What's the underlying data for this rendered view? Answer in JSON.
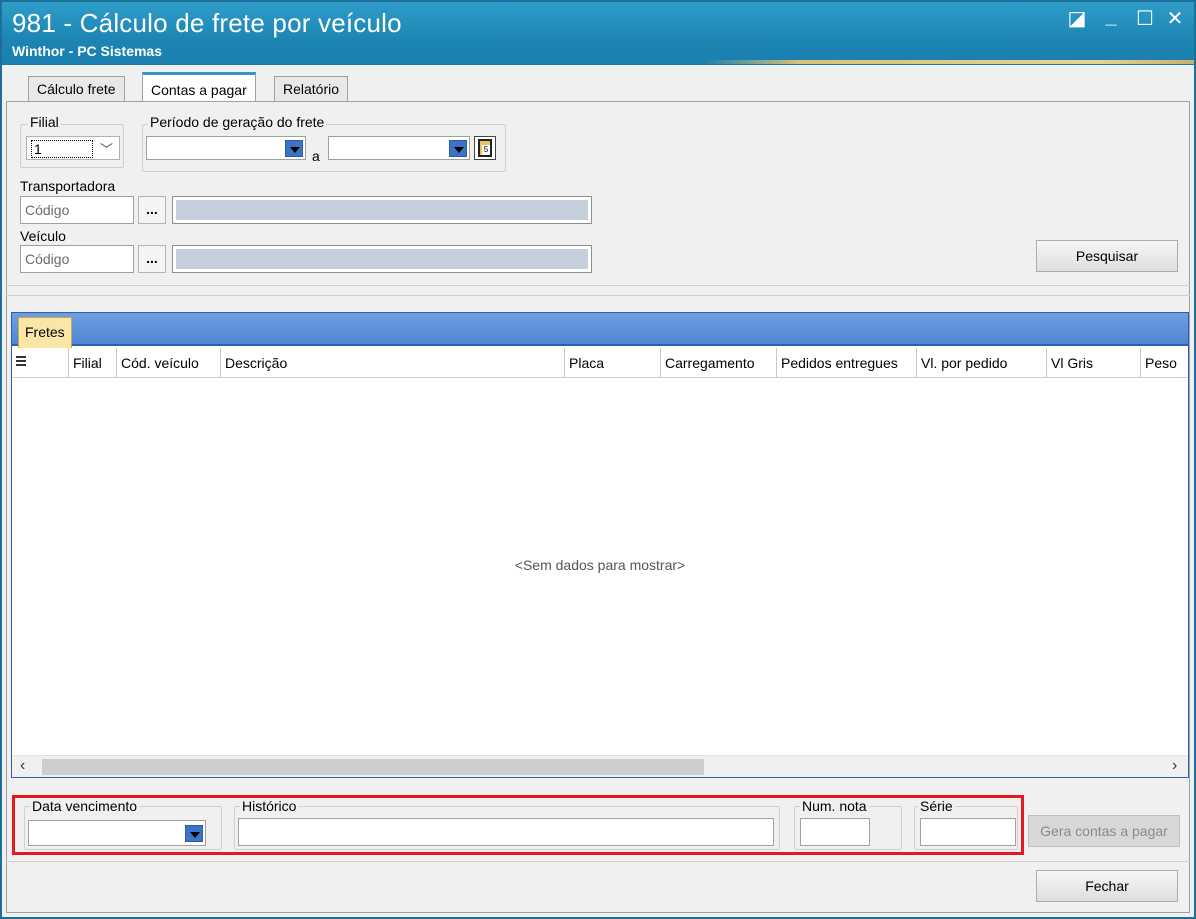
{
  "window": {
    "title": "981 - Cálculo de frete por veículo",
    "subtitle": "Winthor - PC Sistemas",
    "controls": [
      "◪",
      "_",
      "☐",
      "✕"
    ]
  },
  "tabs": [
    {
      "label": "Cálculo frete",
      "active": false
    },
    {
      "label": "Contas a pagar",
      "active": true
    },
    {
      "label": "Relatório",
      "active": false
    }
  ],
  "filters": {
    "filial_label": "Filial",
    "filial_value": "1",
    "periodo_label": "Período de geração do frete",
    "periodo_sep": "a",
    "transportadora_label": "Transportadora",
    "transportadora_placeholder": "Código",
    "veiculo_label": "Veículo",
    "veiculo_placeholder": "Código",
    "ellipsis": "...",
    "search_button": "Pesquisar"
  },
  "grid": {
    "tab": "Fretes",
    "columns": [
      "Filial",
      "Cód. veículo",
      "Descrição",
      "Placa",
      "Carregamento",
      "Pedidos entregues",
      "Vl. por pedido",
      "Vl Gris",
      "Peso"
    ],
    "empty_message": "<Sem dados para mostrar>"
  },
  "footer": {
    "data_vencimento_label": "Data vencimento",
    "historico_label": "Histórico",
    "num_nota_label": "Num. nota",
    "serie_label": "Série",
    "gera_button": "Gera contas a pagar",
    "fechar_button": "Fechar"
  },
  "colors": {
    "title_bar": "#1c85b4",
    "highlight_box": "#e01b24",
    "dropdown_button": "#3b73c6",
    "grid_tab": "#fbe6a5"
  }
}
